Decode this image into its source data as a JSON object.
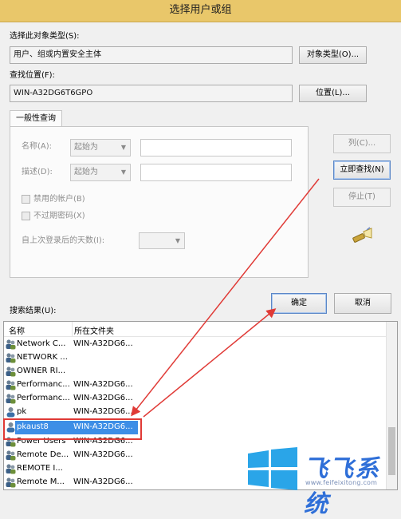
{
  "window": {
    "title": "选择用户或组"
  },
  "object_type": {
    "label": "选择此对象类型(S):",
    "value": "用户、组或内置安全主体",
    "button": "对象类型(O)..."
  },
  "location": {
    "label": "查找位置(F):",
    "value": "WIN-A32DG6T6GPO",
    "button": "位置(L)..."
  },
  "query": {
    "tab": "一般性查询",
    "name_label": "名称(A):",
    "name_mode": "起始为",
    "desc_label": "描述(D):",
    "desc_mode": "起始为",
    "disabled_accounts": "禁用的帐户(B)",
    "non_expiring_pw": "不过期密码(X)",
    "days_since_logon": "自上次登录后的天数(I):"
  },
  "side_buttons": {
    "columns": "列(C)...",
    "find_now": "立即查找(N)",
    "stop": "停止(T)"
  },
  "results": {
    "label": "搜索结果(U):",
    "ok": "确定",
    "cancel": "取消",
    "columns": [
      "名称",
      "所在文件夹"
    ],
    "rows": [
      {
        "name": "Network C...",
        "folder": "WIN-A32DG6...",
        "icon": "group-icon"
      },
      {
        "name": "NETWORK ...",
        "folder": "",
        "icon": "group-icon"
      },
      {
        "name": "OWNER RI...",
        "folder": "",
        "icon": "group-icon"
      },
      {
        "name": "Performanc...",
        "folder": "WIN-A32DG6...",
        "icon": "group-icon"
      },
      {
        "name": "Performanc...",
        "folder": "WIN-A32DG6...",
        "icon": "group-icon"
      },
      {
        "name": "pk",
        "folder": "WIN-A32DG6...",
        "icon": "user-icon"
      },
      {
        "name": "pkaust8",
        "folder": "WIN-A32DG6...",
        "icon": "user-icon",
        "selected": true
      },
      {
        "name": "Power Users",
        "folder": "WIN-A32DG6...",
        "icon": "group-icon"
      },
      {
        "name": "Remote De...",
        "folder": "WIN-A32DG6...",
        "icon": "group-icon"
      },
      {
        "name": "REMOTE I...",
        "folder": "",
        "icon": "group-icon"
      },
      {
        "name": "Remote M...",
        "folder": "WIN-A32DG6...",
        "icon": "group-icon"
      }
    ]
  },
  "watermark": {
    "brand": "飞飞系统",
    "url": "www.feifeixitong.com"
  },
  "colors": {
    "title_bar": "#e9c76a",
    "highlight": "#e03a36",
    "selection": "#3d8ee6",
    "logo": "#2f6fd8"
  }
}
